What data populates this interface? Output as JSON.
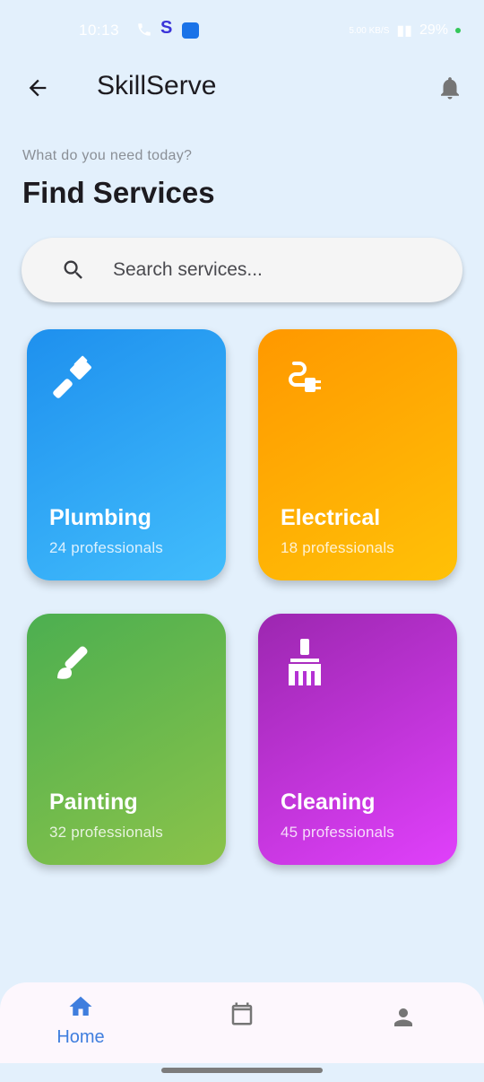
{
  "status_bar": {
    "time": "10:13",
    "s_icon": "S",
    "right_text": "5.00 KB/S",
    "battery": "29%"
  },
  "app_bar": {
    "title": "SkillServe",
    "back_icon": "arrow-back-icon",
    "bell_icon": "bell-icon"
  },
  "header": {
    "subtitle": "What do you need today?",
    "title": "Find Services"
  },
  "search": {
    "placeholder": "Search services...",
    "value": ""
  },
  "services": [
    {
      "name": "Plumbing",
      "count": "24 professionals",
      "icon": "wrench-icon",
      "colors": [
        "#1e90ee",
        "#42bdfc"
      ]
    },
    {
      "name": "Electrical",
      "count": "18 professionals",
      "icon": "plug-icon",
      "colors": [
        "#ff9800",
        "#ffc107"
      ]
    },
    {
      "name": "Painting",
      "count": "32 professionals",
      "icon": "brush-icon",
      "colors": [
        "#4caf50",
        "#8bc34a"
      ]
    },
    {
      "name": "Cleaning",
      "count": "45 professionals",
      "icon": "broom-icon",
      "colors": [
        "#9c27b0",
        "#e040fb"
      ]
    }
  ],
  "bottom_nav": {
    "items": [
      {
        "label": "Home",
        "icon": "home-icon",
        "active": true
      },
      {
        "label": "",
        "icon": "calendar-icon",
        "active": false
      },
      {
        "label": "",
        "icon": "person-icon",
        "active": false
      }
    ],
    "active_color": "#3f7ede",
    "inactive_color": "#757575"
  }
}
